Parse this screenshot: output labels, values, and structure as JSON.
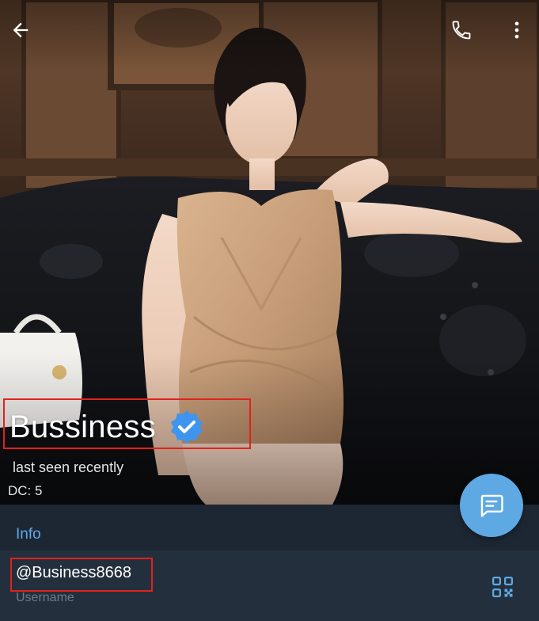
{
  "profile": {
    "name": "Bussiness",
    "verified": true,
    "last_seen": "last seen recently",
    "dc": "DC: 5"
  },
  "info": {
    "header": "Info",
    "username": "@Business8668",
    "username_label": "Username"
  },
  "icons": {
    "back": "arrow-left-icon",
    "call": "phone-icon",
    "menu": "more-vertical-icon",
    "verified": "verified-badge-icon",
    "qr": "qr-code-icon",
    "message": "message-icon"
  },
  "colors": {
    "accent": "#5ea9e4",
    "info_header": "#5fa8e6",
    "background": "#1d2733",
    "row_background": "#242f3d",
    "highlight": "#e0221c",
    "verified_badge": "#3d95f0"
  }
}
